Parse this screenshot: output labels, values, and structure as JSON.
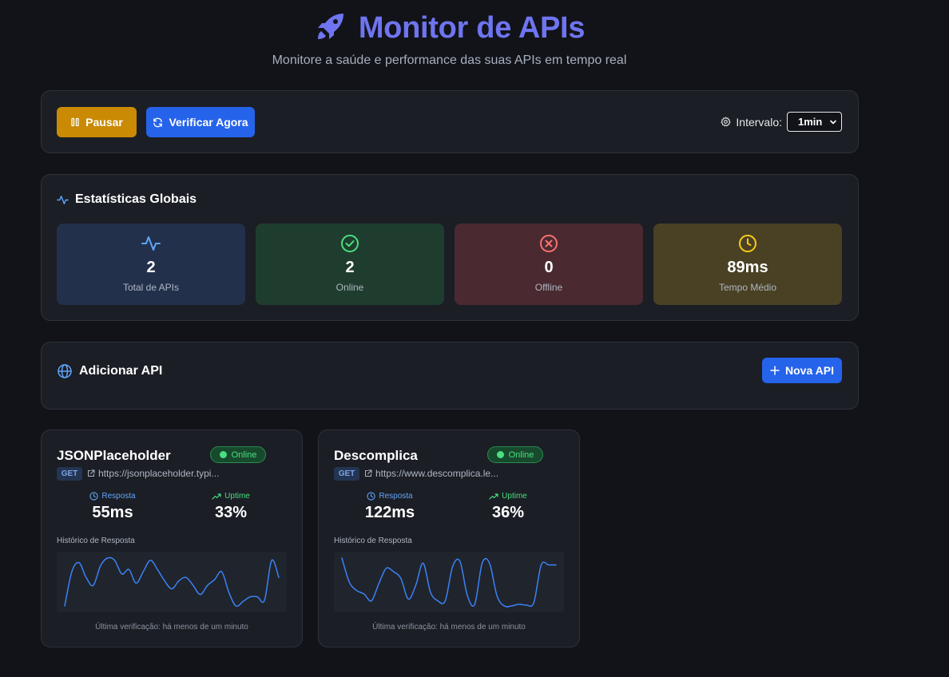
{
  "header": {
    "title": "Monitor de APIs",
    "subtitle": "Monitore a saúde e performance das suas APIs em tempo real",
    "icon": "rocket-icon"
  },
  "controls": {
    "pause_label": "Pausar",
    "verify_label": "Verificar Agora",
    "interval_label": "Intervalo:",
    "interval_value": "1min"
  },
  "stats": {
    "title": "Estatísticas Globais",
    "items": [
      {
        "value": "2",
        "label": "Total de APIs",
        "icon": "activity-icon"
      },
      {
        "value": "2",
        "label": "Online",
        "icon": "check-circle-icon"
      },
      {
        "value": "0",
        "label": "Offline",
        "icon": "x-circle-icon"
      },
      {
        "value": "89ms",
        "label": "Tempo Médio",
        "icon": "clock-icon"
      }
    ]
  },
  "add_api": {
    "title": "Adicionar API",
    "button_label": "Nova API"
  },
  "apis": [
    {
      "name": "JSONPlaceholder",
      "status": "Online",
      "method": "GET",
      "url": "https://jsonplaceholder.typi...",
      "response_label": "Resposta",
      "response_value": "55ms",
      "uptime_label": "Uptime",
      "uptime_value": "33%",
      "history_label": "Histórico de Resposta",
      "last_check": "Última verificação: há menos de um minuto",
      "history": [
        40,
        70,
        78,
        65,
        58,
        75,
        82,
        80,
        68,
        72,
        60,
        70,
        80,
        72,
        62,
        55,
        62,
        65,
        58,
        50,
        58,
        63,
        70,
        52,
        40,
        44,
        48,
        48,
        45,
        80,
        65
      ]
    },
    {
      "name": "Descomplica",
      "status": "Online",
      "method": "GET",
      "url": "https://www.descomplica.le...",
      "response_label": "Resposta",
      "response_value": "122ms",
      "uptime_label": "Uptime",
      "uptime_value": "36%",
      "history_label": "Histórico de Resposta",
      "last_check": "Última verificação: há menos de um minuto",
      "history": [
        160,
        132,
        122,
        118,
        110,
        130,
        148,
        144,
        136,
        112,
        128,
        154,
        120,
        110,
        110,
        150,
        156,
        116,
        106,
        154,
        154,
        116,
        104,
        104,
        106,
        105,
        108,
        152,
        152,
        152
      ]
    }
  ],
  "colors": {
    "accent": "#6f74f0",
    "pause": "#ca8a04",
    "primary": "#2563eb",
    "online": "#4ade80",
    "offline": "#f87171",
    "warning": "#facc15",
    "line": "#3b82f6"
  }
}
